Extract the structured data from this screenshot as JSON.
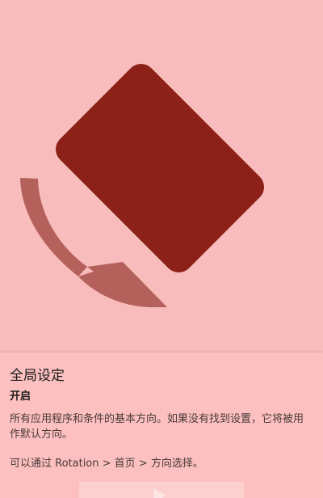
{
  "colors": {
    "background": "#f9bcbc",
    "phone": "#8b2119",
    "arrow": "#b5615b"
  },
  "hero": {
    "phone_icon": "phone-rotated-icon",
    "arrow_icon": "rotate-arrow-icon"
  },
  "setting": {
    "title": "全局设定",
    "status": "开启",
    "description": "所有应用程序和条件的基本方向。如果没有找到设置，它将被用作默认方向。",
    "hint": "可以通过 Rotation > 首页 > 方向选择。"
  },
  "bottom": {
    "icon": "play-icon"
  }
}
